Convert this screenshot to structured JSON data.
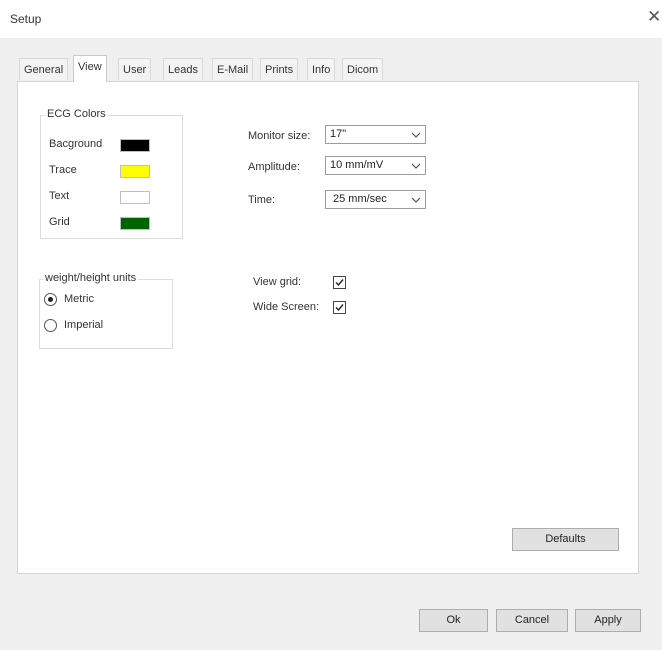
{
  "window": {
    "title": "Setup"
  },
  "tabs": [
    {
      "label": "General"
    },
    {
      "label": "View"
    },
    {
      "label": "User"
    },
    {
      "label": "Leads"
    },
    {
      "label": "E-Mail"
    },
    {
      "label": "Prints"
    },
    {
      "label": "Info"
    },
    {
      "label": "Dicom"
    }
  ],
  "active_tab": "View",
  "ecg_colors": {
    "title": "ECG Colors",
    "items": [
      {
        "label": "Bacground",
        "color": "#000000"
      },
      {
        "label": "Trace",
        "color": "#ffff00"
      },
      {
        "label": "Text",
        "color": "#ffffff"
      },
      {
        "label": "Grid",
        "color": "#006400"
      }
    ]
  },
  "monitor_size": {
    "label": "Monitor size:",
    "value": "17\""
  },
  "amplitude": {
    "label": "Amplitude:",
    "value": "10 mm/mV"
  },
  "time": {
    "label": "Time:",
    "value": "25 mm/sec"
  },
  "units": {
    "title": "weight/height units",
    "options": [
      {
        "label": "Metric",
        "selected": true
      },
      {
        "label": "Imperial",
        "selected": false
      }
    ]
  },
  "view_grid": {
    "label": "View grid:",
    "checked": true
  },
  "wide_screen": {
    "label": "Wide Screen:",
    "checked": true
  },
  "buttons": {
    "defaults": "Defaults",
    "ok": "Ok",
    "cancel": "Cancel",
    "apply": "Apply"
  }
}
